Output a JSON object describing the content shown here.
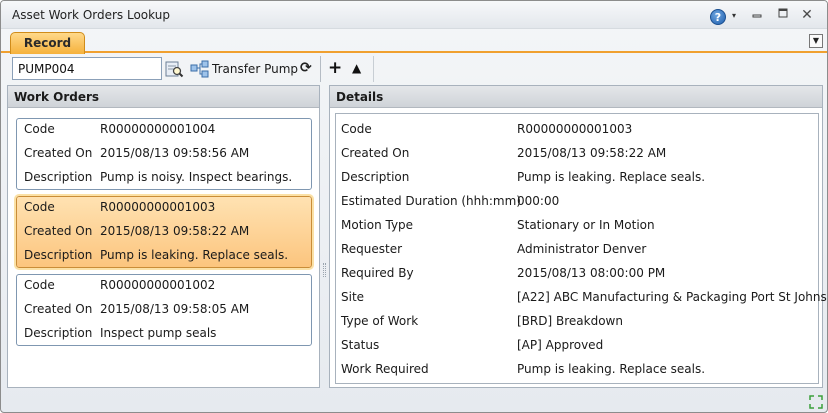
{
  "window": {
    "title": "Asset Work Orders Lookup",
    "help_glyph": "?",
    "dropdown_glyph": "▾",
    "min_glyph": "▭",
    "max_glyph": "□",
    "close_glyph": "✕"
  },
  "tabs": {
    "record_label": "Record",
    "menu_glyph": "▼"
  },
  "toolbar": {
    "search_value": "PUMP004",
    "transfer_label": "Transfer Pump",
    "refresh_glyph": "⟳",
    "add_glyph": "+",
    "up_glyph": "▲"
  },
  "work_orders": {
    "header": "Work Orders",
    "items": [
      {
        "code_label": "Code",
        "code": "R00000000001004",
        "created_label": "Created On",
        "created": "2015/08/13 09:58:56 AM",
        "desc_label": "Description",
        "desc": "Pump is noisy. Inspect bearings."
      },
      {
        "code_label": "Code",
        "code": "R00000000001003",
        "created_label": "Created On",
        "created": "2015/08/13 09:58:22 AM",
        "desc_label": "Description",
        "desc": "Pump is leaking. Replace seals."
      },
      {
        "code_label": "Code",
        "code": "R00000000001002",
        "created_label": "Created On",
        "created": "2015/08/13 09:58:05 AM",
        "desc_label": "Description",
        "desc": "Inspect pump seals"
      }
    ]
  },
  "details": {
    "header": "Details",
    "fields": [
      {
        "label": "Code",
        "value": "R00000000001003"
      },
      {
        "label": "Created On",
        "value": "2015/08/13 09:58:22 AM"
      },
      {
        "label": "Description",
        "value": "Pump is leaking. Replace seals."
      },
      {
        "label": "Estimated Duration (hhh:mm)",
        "value": "000:00"
      },
      {
        "label": "Motion Type",
        "value": "Stationary or In Motion"
      },
      {
        "label": "Requester",
        "value": "Administrator Denver"
      },
      {
        "label": "Required By",
        "value": "2015/08/13 08:00:00 PM"
      },
      {
        "label": "Site",
        "value": "[A22] ABC Manufacturing & Packaging Port St Johns"
      },
      {
        "label": "Type of Work",
        "value": "[BRD] Breakdown"
      },
      {
        "label": "Status",
        "value": "[AP] Approved"
      },
      {
        "label": "Work Required",
        "value": "Pump is leaking. Replace seals."
      }
    ]
  },
  "colors": {
    "accent": "#f5b13c",
    "selection": "#fcc57e",
    "header": "#cfd3d8"
  }
}
